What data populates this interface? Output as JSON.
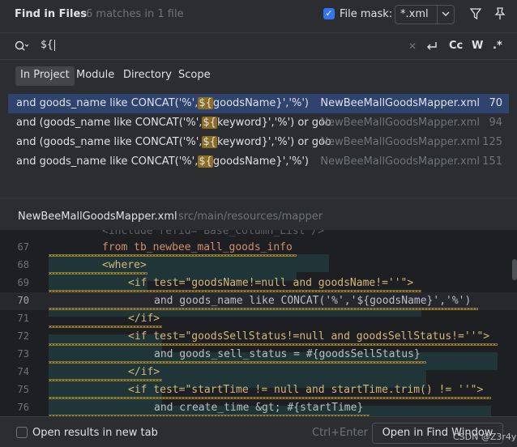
{
  "header": {
    "title": "Find in Files",
    "matches": "6 matches in 1 file",
    "file_mask_label": "File mask:",
    "file_mask_value": "*.xml"
  },
  "search": {
    "query": "${",
    "toggle_case": "Cc",
    "toggle_words": "W",
    "toggle_regex": ".*"
  },
  "scopes": [
    {
      "label": "In Project",
      "active": true
    },
    {
      "label": "Module",
      "active": false
    },
    {
      "label": "Directory",
      "active": false
    },
    {
      "label": "Scope",
      "active": false
    }
  ],
  "results": [
    {
      "pre": "and goods_name like CONCAT('%',",
      "match": "${",
      "post": "goodsName}','%')",
      "file": "NewBeeMallGoodsMapper.xml",
      "line": "70",
      "selected": true
    },
    {
      "pre": "and (goods_name like CONCAT('%',",
      "match": "${",
      "post": "keyword}','%') or goods",
      "file": "NewBeeMallGoodsMapper.xml",
      "line": "94",
      "selected": false
    },
    {
      "pre": "and (goods_name like CONCAT('%',",
      "match": "${",
      "post": "keyword}','%') or good",
      "file": "NewBeeMallGoodsMapper.xml",
      "line": "125",
      "selected": false
    },
    {
      "pre": "and goods_name like CONCAT('%',",
      "match": "${",
      "post": "goodsName}','%')",
      "file": "NewBeeMallGoodsMapper.xml",
      "line": "151",
      "selected": false
    }
  ],
  "preview": {
    "file": "NewBeeMallGoodsMapper.xml",
    "path": "src/main/resources/mapper"
  },
  "code": [
    {
      "ln": "",
      "text": "<include refid=\"Base_Column_List\"/>"
    },
    {
      "ln": "67",
      "text": "from tb_newbee_mall_goods_info"
    },
    {
      "ln": "68",
      "text": "<where>"
    },
    {
      "ln": "69",
      "text": "<if test=\"goodsName!=null and goodsName!=''\">"
    },
    {
      "ln": "70",
      "text": "and goods_name like CONCAT('%','${goodsName}','%')"
    },
    {
      "ln": "71",
      "text": "</if>"
    },
    {
      "ln": "72",
      "text": "<if test=\"goodsSellStatus!=null and goodsSellStatus!=''\">"
    },
    {
      "ln": "73",
      "text": "and goods_sell_status = #{goodsSellStatus}"
    },
    {
      "ln": "74",
      "text": "</if>"
    },
    {
      "ln": "75",
      "text": "<if test=\"startTime != null and startTime.trim() != ''\">"
    },
    {
      "ln": "76",
      "text": "and create_time &gt; #{startTime}"
    }
  ],
  "footer": {
    "open_new_tab": "Open results in new tab",
    "shortcut": "Ctrl+Enter",
    "open_button": "Open in Find Window"
  },
  "watermark": "CSDN @Z3r4y",
  "colors": {
    "accent": "#3574f0",
    "selection": "#2e436e",
    "match_highlight": "#8c6d22"
  }
}
